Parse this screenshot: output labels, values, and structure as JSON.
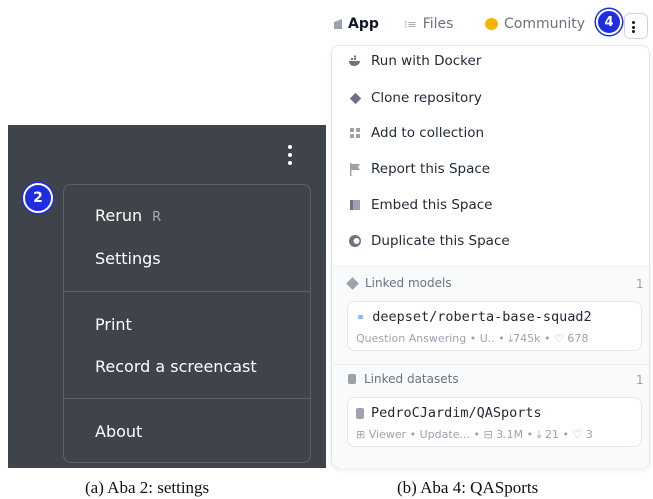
{
  "panel_a": {
    "badge": "2",
    "menu": {
      "rerun_label": "Rerun",
      "rerun_shortcut": "R",
      "settings_label": "Settings",
      "print_label": "Print",
      "record_label": "Record a screencast",
      "about_label": "About"
    },
    "caption": "(a) Aba 2: settings"
  },
  "panel_b": {
    "badge": "4",
    "tabs": {
      "app": "App",
      "files": "Files",
      "community": "Community"
    },
    "menu": {
      "run_docker": "Run with Docker",
      "clone_repo": "Clone repository",
      "add_collection": "Add to collection",
      "report": "Report this Space",
      "embed": "Embed this Space",
      "duplicate": "Duplicate this Space"
    },
    "linked_models": {
      "label": "Linked models",
      "count": "1",
      "name": "deepset/roberta-base-squad2",
      "task": "Question Answering",
      "updated": "U..",
      "downloads": "745k",
      "likes": "678"
    },
    "linked_datasets": {
      "label": "Linked datasets",
      "count": "1",
      "name": "PedroCJardim/QASports",
      "viewer": "Viewer",
      "updated": "Update...",
      "rows": "3.1M",
      "downloads": "21",
      "likes": "3"
    },
    "caption": "(b) Aba 4: QASports"
  },
  "colors": {
    "dark_bg": "#3e4449",
    "badge_blue": "#1e2de0",
    "community_yellow": "#f5b400"
  }
}
